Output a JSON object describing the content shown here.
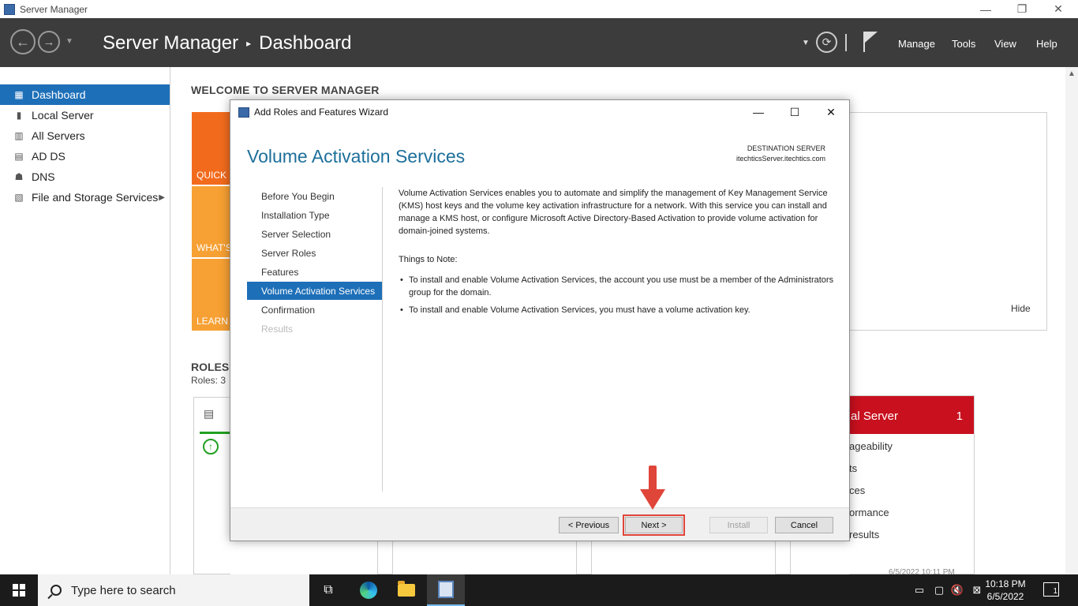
{
  "window": {
    "title": "Server Manager"
  },
  "header": {
    "breadcrumb_app": "Server Manager",
    "breadcrumb_sep": "▸",
    "breadcrumb_page": "Dashboard",
    "menu": [
      "Manage",
      "Tools",
      "View",
      "Help"
    ]
  },
  "sidebar": {
    "items": [
      {
        "label": "Dashboard",
        "icon": "dashboard-icon",
        "active": true
      },
      {
        "label": "Local Server",
        "icon": "server-icon"
      },
      {
        "label": "All Servers",
        "icon": "servers-icon"
      },
      {
        "label": "AD DS",
        "icon": "ad-ds-icon"
      },
      {
        "label": "DNS",
        "icon": "dns-icon"
      },
      {
        "label": "File and Storage Services",
        "icon": "storage-icon",
        "has_submenu": true
      }
    ]
  },
  "main": {
    "welcome_title": "WELCOME TO SERVER MANAGER",
    "tiles": [
      "QUICK S",
      "WHAT'S",
      "LEARN M"
    ],
    "hide_label": "Hide",
    "roles_title": "ROLES A",
    "roles_count": "Roles: 3",
    "server_card": {
      "title": "al Server",
      "count": "1",
      "lines": [
        "ageability",
        "ts",
        "ces",
        "ormance",
        "results"
      ]
    },
    "timestamp": "6/5/2022 10:11 PM"
  },
  "dialog": {
    "title": "Add Roles and Features Wizard",
    "heading": "Volume Activation Services",
    "destination_label": "DESTINATION SERVER",
    "destination_server": "itechticsServer.itechtics.com",
    "steps": [
      {
        "label": "Before You Begin",
        "state": "normal"
      },
      {
        "label": "Installation Type",
        "state": "normal"
      },
      {
        "label": "Server Selection",
        "state": "normal"
      },
      {
        "label": "Server Roles",
        "state": "normal"
      },
      {
        "label": "Features",
        "state": "normal"
      },
      {
        "label": "Volume Activation Services",
        "state": "active"
      },
      {
        "label": "Confirmation",
        "state": "normal"
      },
      {
        "label": "Results",
        "state": "disabled"
      }
    ],
    "description": "Volume Activation Services enables you to automate and simplify the management of Key Management Service (KMS) host keys and the volume key activation infrastructure for a network. With this service you can install and manage a KMS host, or configure Microsoft Active Directory-Based Activation to provide volume activation for domain-joined systems.",
    "notes_title": "Things to Note:",
    "notes": [
      "To install and enable Volume Activation Services, the account you use must be a member of the Administrators group for the domain.",
      "To install and enable Volume Activation Services, you must have a volume activation key."
    ],
    "buttons": {
      "previous": "< Previous",
      "next": "Next >",
      "install": "Install",
      "cancel": "Cancel"
    }
  },
  "taskbar": {
    "search_placeholder": "Type here to search",
    "time": "10:18 PM",
    "date": "6/5/2022",
    "notification_count": "1"
  },
  "colors": {
    "accent": "#1d6fb8",
    "header_bg": "#3c3c3c",
    "heading_blue": "#1e6f9b",
    "tile_orange": "#f26b1d",
    "tile_light_orange": "#f7a033",
    "alert_red": "#c8101e",
    "annotation_red": "#e0453a"
  }
}
